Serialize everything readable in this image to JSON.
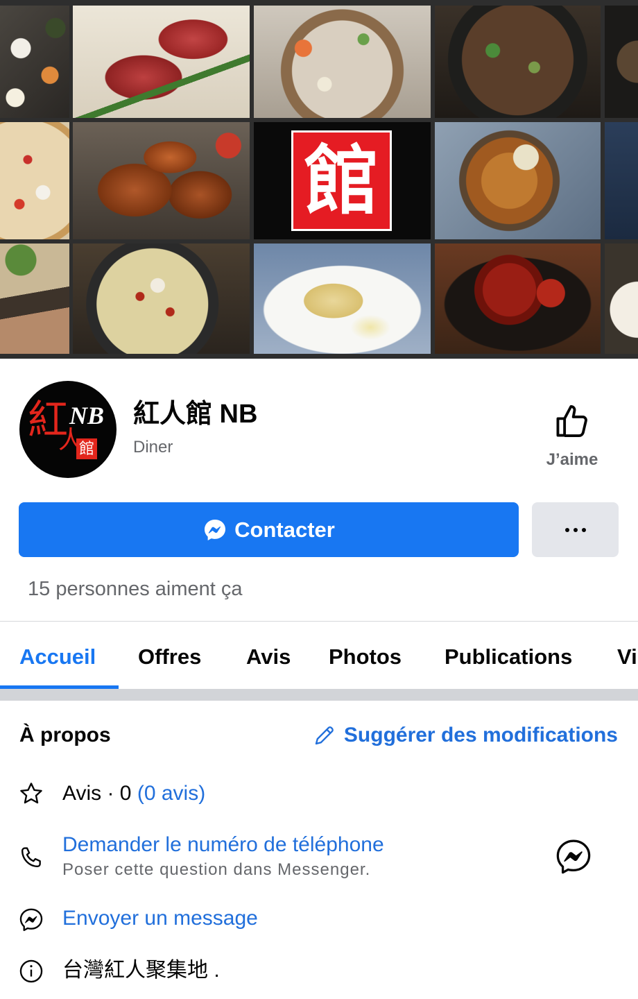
{
  "cover": {
    "logo_char": "館"
  },
  "profile": {
    "avatar": {
      "char_1": "紅",
      "char_2": "人",
      "latin": "NB",
      "box_char": "館"
    },
    "name": "紅人館 NB",
    "category": "Diner",
    "like_label": "J’aime",
    "like_icon": "thumbs-up-icon"
  },
  "actions": {
    "contact_label": "Contacter",
    "contact_icon": "messenger-icon",
    "more_icon": "more-icon"
  },
  "likes_text": "15 personnes aiment ça",
  "tabs": [
    {
      "label": "Accueil",
      "active": true
    },
    {
      "label": "Offres",
      "active": false
    },
    {
      "label": "Avis",
      "active": false
    },
    {
      "label": "Photos",
      "active": false
    },
    {
      "label": "Publications",
      "active": false
    },
    {
      "label": "Vi",
      "active": false
    }
  ],
  "about": {
    "title": "À propos",
    "suggest_label": "Suggérer des modifications",
    "suggest_icon": "pencil-icon",
    "rating": {
      "text": "Avis · 0",
      "link": "(0 avis)",
      "icon": "star-icon"
    },
    "phone": {
      "label": "Demander le numéro de téléphone",
      "sub": "Poser cette question dans Messenger.",
      "icon": "phone-icon",
      "action_icon": "messenger-icon"
    },
    "message": {
      "label": "Envoyer un message",
      "icon": "messenger-icon"
    },
    "description": {
      "text": "台灣紅人聚集地 .",
      "icon": "info-icon"
    }
  },
  "colors": {
    "accent": "#1877f2",
    "link": "#216fdb",
    "secondary_text": "#65676b",
    "primary_text": "#050505",
    "button_secondary": "#e4e6eb"
  }
}
